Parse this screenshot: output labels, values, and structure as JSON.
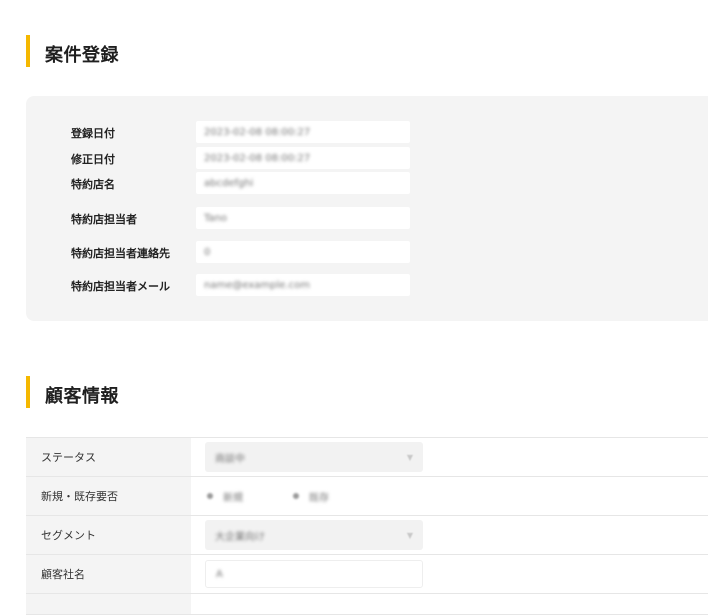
{
  "sections": {
    "registration": {
      "title": "案件登録",
      "fields": [
        {
          "label": "登録日付",
          "value": "2023-02-08 08:00:27"
        },
        {
          "label": "修正日付",
          "value": "2023-02-08 08:00:27"
        },
        {
          "label": "特約店名",
          "value": "abcdefghi"
        },
        {
          "label": "特約店担当者",
          "value": "Tano"
        },
        {
          "label": "特約店担当者連絡先",
          "value": "0"
        },
        {
          "label": "特約店担当者メール",
          "value": "name@example.com"
        }
      ]
    },
    "customer": {
      "title": "顧客情報",
      "status": {
        "label": "ステータス",
        "value": "商談中",
        "icon": "chevron-down-icon"
      },
      "new_existing": {
        "label": "新規・既存要否",
        "option1": "新規",
        "option2": "既存"
      },
      "segment": {
        "label": "セグメント",
        "value": "大企業向け",
        "icon": "chevron-down-icon"
      },
      "company": {
        "label": "顧客社名",
        "value": "A"
      }
    }
  },
  "colors": {
    "accent": "#f5b800",
    "card_bg": "#f4f4f4",
    "label_bg": "#f4f4f4"
  }
}
